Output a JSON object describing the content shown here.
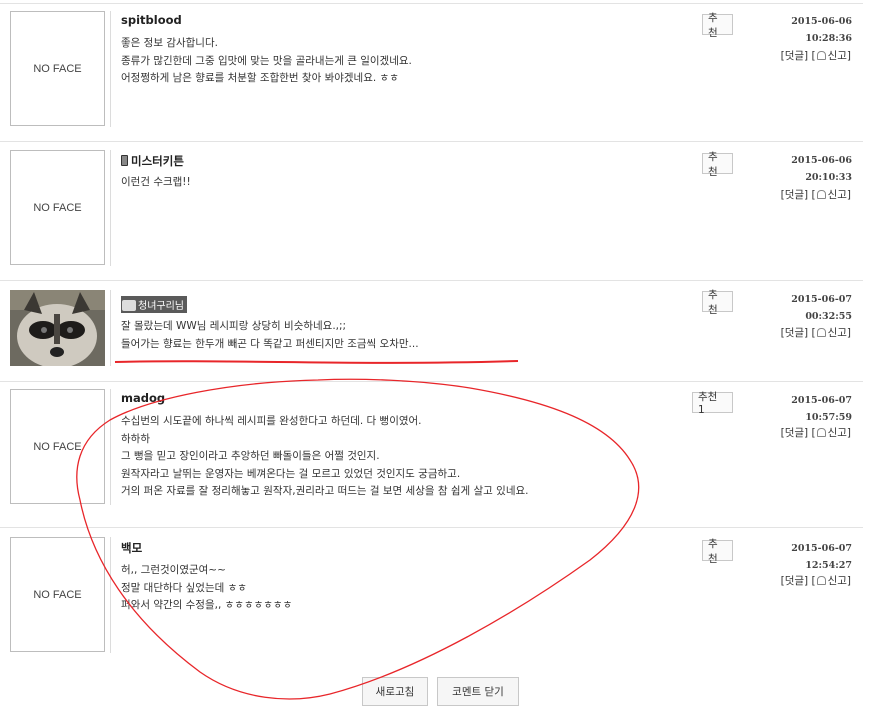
{
  "comments": [
    {
      "avatar_text": "NO FACE",
      "author": "spitblood",
      "lines": [
        "좋은 정보 감사합니다.",
        "종류가 많긴한데 그중 입맛에 맞는 맛을 골라내는게 큰 일이겠네요.",
        "어정쩡하게 남은 향료를 처분할 조합한번 찾아 봐야겠네요. ㅎㅎ"
      ],
      "recommend_label": "추천",
      "date": "2015-06-06",
      "time": "10:28:36"
    },
    {
      "avatar_text": "NO FACE",
      "author": "미스터키튼",
      "lines": [
        "이런건 수크랩!!"
      ],
      "recommend_label": "추천",
      "date": "2015-06-06",
      "time": "20:10:33"
    },
    {
      "avatar_text": "",
      "author": "청녀구리님",
      "lines": [
        "잘 몰랐는데 WW님 레시피랑 상당히 비슷하네요.,;;",
        "들어가는 향료는 한두개 빼곤 다 똑같고 퍼센티지만 조금씩 오차만..."
      ],
      "recommend_label": "추천",
      "date": "2015-06-07",
      "time": "00:32:55"
    },
    {
      "avatar_text": "NO FACE",
      "author": "madog",
      "lines": [
        "수십번의 시도끝에 하나씩 레시피를 완성한다고 하던데. 다 뻥이였어.",
        "하하하",
        "그 뻥을 믿고 장인이라고 추앙하던 빠돌이들은 어쩔 것인지.",
        "원작자라고 날뛰는 운영자는 베껴온다는 걸 모르고 있었던 것인지도 궁금하고.",
        "거의 퍼온 자료를 잘 정리해놓고 원작자,권리라고 떠드는 걸 보면 세상을 참 쉽게 살고 있네요."
      ],
      "recommend_label": "추천 1",
      "date": "2015-06-07",
      "time": "10:57:59"
    },
    {
      "avatar_text": "NO FACE",
      "author": "백모",
      "lines": [
        "허,, 그런것이였군여~~",
        "정말 대단하다 싶었는데 ㅎㅎ",
        "퍼와서 약간의 수정을,, ㅎㅎㅎㅎㅎㅎㅎ"
      ],
      "recommend_label": "추천",
      "date": "2015-06-07",
      "time": "12:54:27"
    }
  ],
  "actions": {
    "reply_label": "[덧글]",
    "report_open": "[",
    "report_label": "신고]"
  },
  "buttons": {
    "refresh": "새로고침",
    "close_comments": "코멘트 닫기"
  },
  "colors": {
    "annotation": "#e8262a"
  }
}
